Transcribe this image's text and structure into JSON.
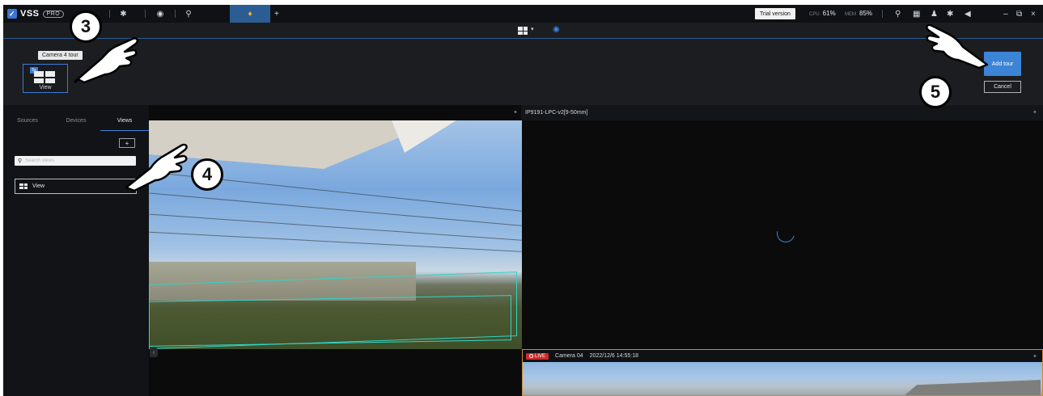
{
  "topbar": {
    "brand": "VSS",
    "edition": "PRO",
    "trial": "Trial version",
    "cpu_label": "CPU",
    "cpu_value": "61%",
    "mem_label": "MEM",
    "mem_value": "85%",
    "add_tab": "+",
    "window_minimize": "–",
    "window_close": "×"
  },
  "tour_editor": {
    "tooltip": "Camera 4 tour",
    "card_label": "View",
    "card_badge": "5s",
    "add_button": "Add tour",
    "cancel_button": "Cancel"
  },
  "sidebar": {
    "tabs": [
      "Sources",
      "Devices",
      "Views"
    ],
    "active_tab": "Views",
    "add_button": "+",
    "search_placeholder": "Search views",
    "views": [
      {
        "label": "View"
      }
    ]
  },
  "tiles": {
    "tile2_title": "IP9191-LPC-v2[9-50mm]",
    "cam4_live": "LIVE",
    "cam4_name": "Camera 04",
    "cam4_timestamp": "2022/12/6 14:55:18"
  },
  "annotations": {
    "step3": "3",
    "step4": "4",
    "step5": "5"
  },
  "colors": {
    "accent": "#3b84d6",
    "highlight_border": "#d2862e",
    "live": "#cc2b2b",
    "detection": "#32d4c6"
  }
}
